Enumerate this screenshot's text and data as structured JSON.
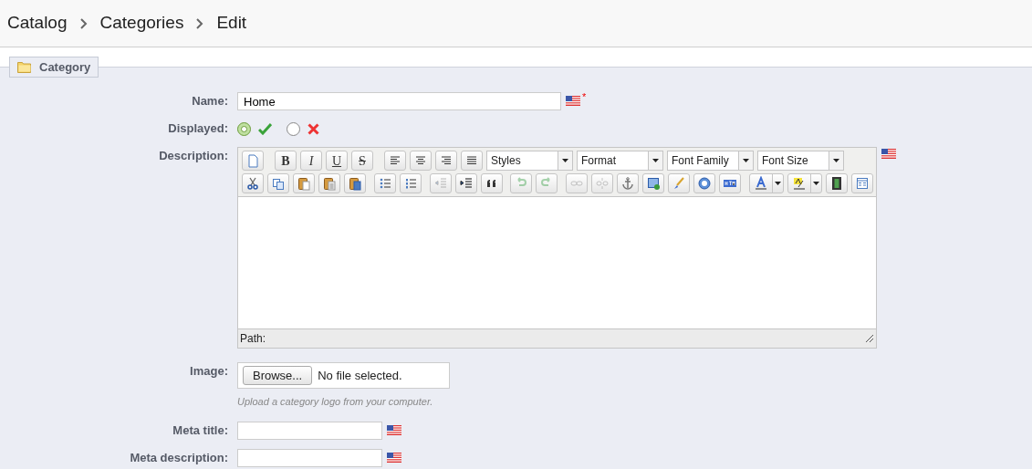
{
  "breadcrumb": [
    {
      "label": "Catalog"
    },
    {
      "label": "Categories"
    },
    {
      "label": "Edit"
    }
  ],
  "fieldset": {
    "legend": "Category"
  },
  "fields": [
    {
      "kind": "text",
      "label": "Name:",
      "value": "Home",
      "required_mark": "*"
    },
    {
      "kind": "toggle",
      "label": "Displayed:",
      "options": [
        {
          "kind": "yes",
          "selected": true
        },
        {
          "kind": "no",
          "selected": false
        }
      ]
    },
    {
      "kind": "editor",
      "label": "Description:",
      "path_label": "Path:",
      "toolbar": [
        [
          {
            "kind": "icon",
            "disabled": false
          },
          {
            "kind": "sep"
          },
          {
            "kind": "text",
            "text": "B",
            "disabled": false
          },
          {
            "kind": "text",
            "text": "I",
            "disabled": false
          },
          {
            "kind": "text",
            "text": "U",
            "disabled": false
          },
          {
            "kind": "text",
            "text": "S",
            "disabled": false
          },
          {
            "kind": "sep"
          },
          {
            "kind": "icon",
            "disabled": false
          },
          {
            "kind": "icon",
            "disabled": false
          },
          {
            "kind": "icon",
            "disabled": false
          },
          {
            "kind": "icon",
            "disabled": false
          },
          {
            "kind": "select",
            "label": "Styles"
          },
          {
            "kind": "select",
            "label": "Format"
          },
          {
            "kind": "select",
            "label": "Font Family"
          },
          {
            "kind": "select",
            "label": "Font Size"
          }
        ],
        [
          {
            "kind": "icon",
            "disabled": false
          },
          {
            "kind": "icon",
            "disabled": false
          },
          {
            "kind": "icon",
            "disabled": false
          },
          {
            "kind": "icon",
            "disabled": false
          },
          {
            "kind": "icon",
            "disabled": false
          },
          {
            "kind": "sep"
          },
          {
            "kind": "icon",
            "disabled": false
          },
          {
            "kind": "icon",
            "disabled": false
          },
          {
            "kind": "sep"
          },
          {
            "kind": "icon",
            "disabled": true
          },
          {
            "kind": "icon",
            "disabled": false
          },
          {
            "kind": "icon",
            "disabled": false
          },
          {
            "kind": "sep"
          },
          {
            "kind": "icon",
            "disabled": true
          },
          {
            "kind": "icon",
            "disabled": true
          },
          {
            "kind": "sep"
          },
          {
            "kind": "icon",
            "disabled": true
          },
          {
            "kind": "icon",
            "disabled": true
          },
          {
            "kind": "icon",
            "disabled": false
          },
          {
            "kind": "icon",
            "disabled": false
          },
          {
            "kind": "icon",
            "disabled": false
          },
          {
            "kind": "icon",
            "disabled": false
          },
          {
            "kind": "icon",
            "disabled": false
          },
          {
            "kind": "sep"
          },
          {
            "kind": "split",
            "disabled": false
          },
          {
            "kind": "split",
            "disabled": false
          },
          {
            "kind": "icon",
            "disabled": false
          },
          {
            "kind": "icon",
            "disabled": false
          }
        ]
      ]
    },
    {
      "kind": "file",
      "label": "Image:",
      "button": "Browse...",
      "status": "No file selected.",
      "hint": "Upload a category logo from your computer."
    },
    {
      "kind": "text",
      "label": "Meta title:"
    },
    {
      "kind": "text",
      "label": "Meta description:"
    }
  ]
}
